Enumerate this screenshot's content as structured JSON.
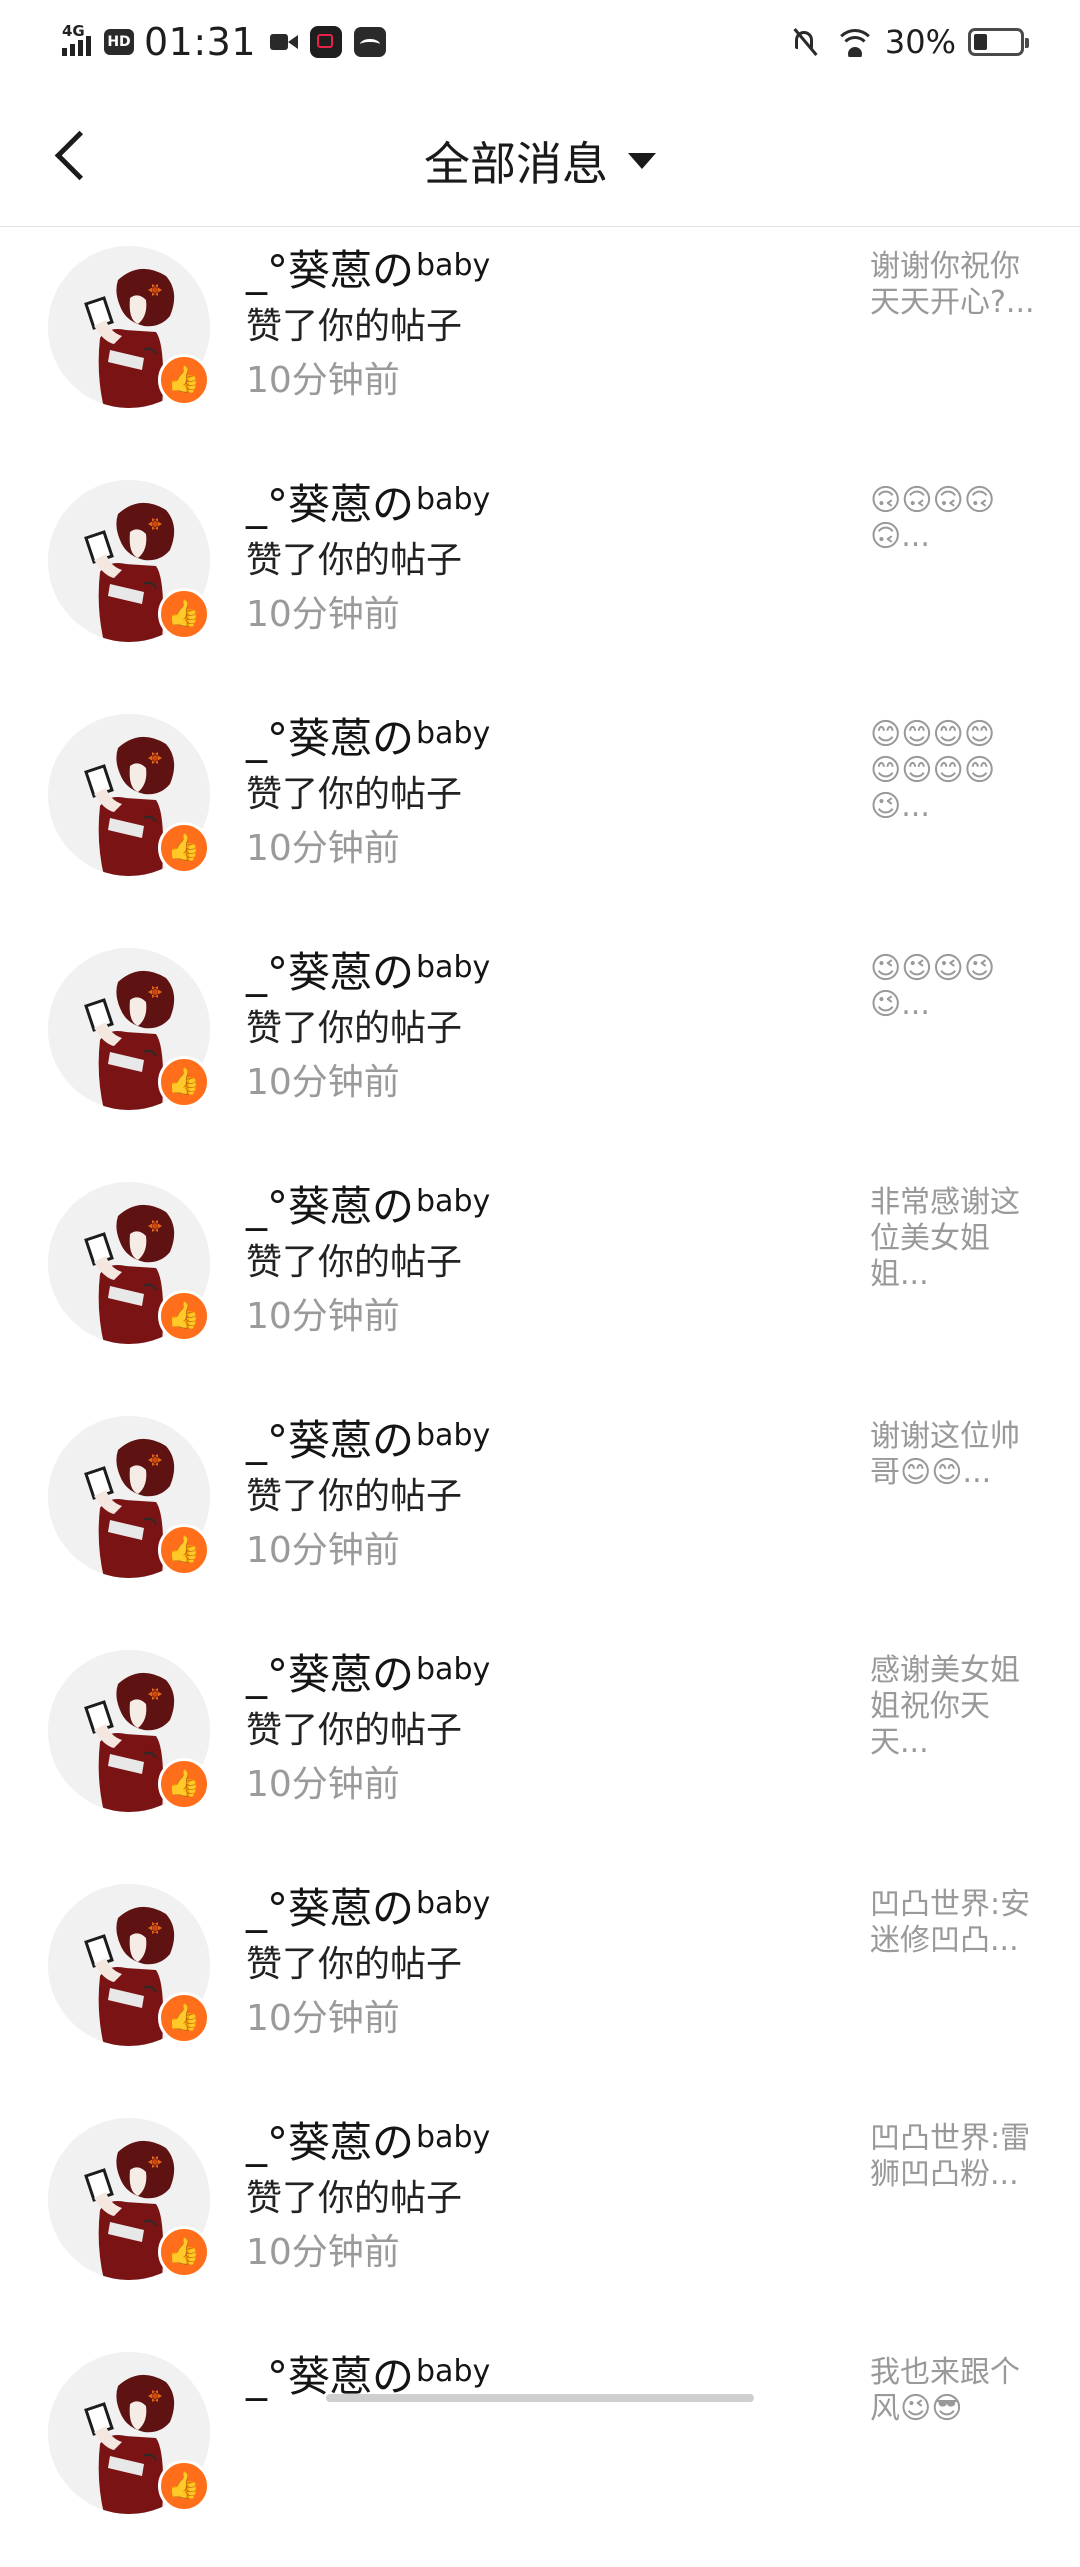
{
  "status_bar": {
    "network": "4G",
    "hd": "HD",
    "time": "01:31",
    "battery_text": "30%",
    "battery_level": 0.3
  },
  "header": {
    "title": "全部消息"
  },
  "messages": [
    {
      "name": "_°葵蒽の",
      "name_sup": "baby",
      "action": "赞了你的帖子",
      "time": "10分钟前",
      "preview": "谢谢你祝你\n天天开心?..."
    },
    {
      "name": "_°葵蒽の",
      "name_sup": "baby",
      "action": "赞了你的帖子",
      "time": "10分钟前",
      "preview": "🙃🙃🙃🙃\n🙃..."
    },
    {
      "name": "_°葵蒽の",
      "name_sup": "baby",
      "action": "赞了你的帖子",
      "time": "10分钟前",
      "preview": "😊😊😊😊\n😊😊😊😊\n😉..."
    },
    {
      "name": "_°葵蒽の",
      "name_sup": "baby",
      "action": "赞了你的帖子",
      "time": "10分钟前",
      "preview": "😉😉😉😉\n😉..."
    },
    {
      "name": "_°葵蒽の",
      "name_sup": "baby",
      "action": "赞了你的帖子",
      "time": "10分钟前",
      "preview": "非常感谢这\n位美女姐\n姐..."
    },
    {
      "name": "_°葵蒽の",
      "name_sup": "baby",
      "action": "赞了你的帖子",
      "time": "10分钟前",
      "preview": "谢谢这位帅\n哥😊😊..."
    },
    {
      "name": "_°葵蒽の",
      "name_sup": "baby",
      "action": "赞了你的帖子",
      "time": "10分钟前",
      "preview": "感谢美女姐\n姐祝你天\n天..."
    },
    {
      "name": "_°葵蒽の",
      "name_sup": "baby",
      "action": "赞了你的帖子",
      "time": "10分钟前",
      "preview": "凹凸世界:安\n迷修凹凸..."
    },
    {
      "name": "_°葵蒽の",
      "name_sup": "baby",
      "action": "赞了你的帖子",
      "time": "10分钟前",
      "preview": "凹凸世界:雷\n狮凹凸粉..."
    },
    {
      "name": "_°葵蒽の",
      "name_sup": "baby",
      "action": "",
      "time": "",
      "preview": "我也来跟个\n风😉😎"
    }
  ],
  "icons": {
    "like_badge": "thumbs-up-icon",
    "back": "chevron-left-icon",
    "dropdown": "caret-down-icon"
  },
  "colors": {
    "badge": "#ff6e1b",
    "time_text": "#9a9a9a",
    "preview_text": "#999999"
  }
}
